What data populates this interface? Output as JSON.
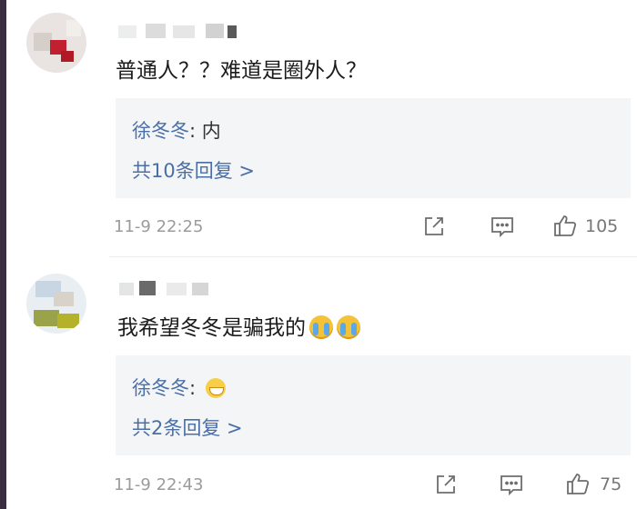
{
  "comments": [
    {
      "text": "普通人？？难道是圈外人？",
      "emojis": [],
      "reply_author": "徐冬冬",
      "reply_sep": ": ",
      "reply_text": "内",
      "reply_emoji": "",
      "reply_count_label": "共10条回复 >",
      "time": "11-9 22:25",
      "likes": "105"
    },
    {
      "text": "我希望冬冬是骗我的",
      "emojis": [
        "crying-emoji",
        "crying-emoji"
      ],
      "reply_author": "徐冬冬",
      "reply_sep": ": ",
      "reply_text": "",
      "reply_emoji": "grinning-emoji",
      "reply_count_label": "共2条回复 >",
      "time": "11-9 22:43",
      "likes": "75"
    }
  ],
  "icons": [
    "share-icon",
    "comment-icon",
    "like-icon"
  ],
  "colors": {
    "link_blue": "#4a6ea6",
    "reply_bg": "#f4f5f7",
    "meta_gray": "#9b9b9b"
  }
}
